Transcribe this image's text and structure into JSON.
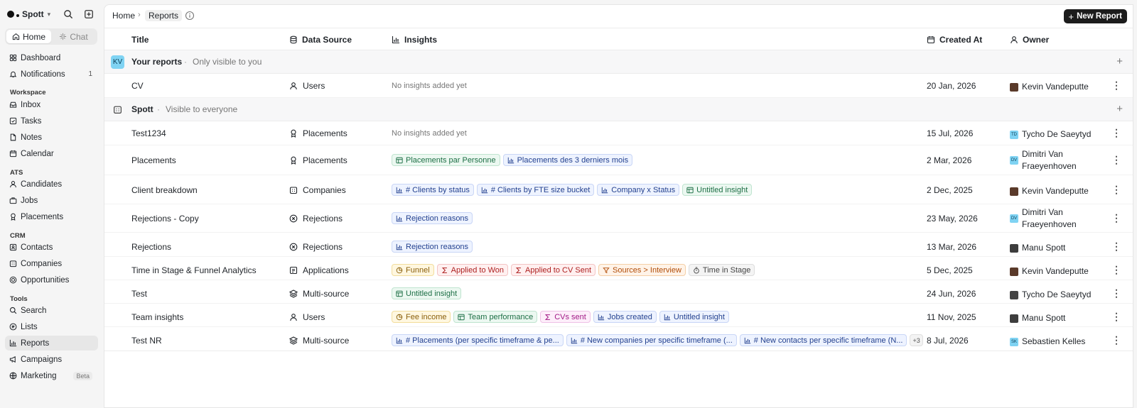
{
  "app": {
    "name": "Spott"
  },
  "sidebar": {
    "tabs": {
      "home": "Home",
      "chat": "Chat"
    },
    "top_items": [
      {
        "label": "Dashboard"
      },
      {
        "label": "Notifications",
        "count": "1"
      }
    ],
    "sections": {
      "workspace": "Workspace",
      "ats": "ATS",
      "crm": "CRM",
      "tools": "Tools"
    },
    "workspace_items": [
      "Inbox",
      "Tasks",
      "Notes",
      "Calendar"
    ],
    "ats_items": [
      "Candidates",
      "Jobs",
      "Placements"
    ],
    "crm_items": [
      "Contacts",
      "Companies",
      "Opportunities"
    ],
    "tools_items": [
      "Search",
      "Lists",
      "Reports",
      "Campaigns",
      "Marketing"
    ],
    "beta_label": "Beta"
  },
  "breadcrumb": {
    "home": "Home",
    "current": "Reports"
  },
  "toolbar": {
    "new_report": "New Report"
  },
  "columns": {
    "title": "Title",
    "data_source": "Data Source",
    "insights": "Insights",
    "created_at": "Created At",
    "owner": "Owner"
  },
  "groups": {
    "yours": {
      "badge": "KV",
      "title": "Your reports",
      "subtitle": "Only visible to you"
    },
    "spott": {
      "title": "Spott",
      "subtitle": "Visible to everyone"
    }
  },
  "empty_insights": "No insights added yet",
  "rows": [
    {
      "title": "CV",
      "source": "Users",
      "date": "20 Jan, 2026",
      "owner": "Kevin Vandeputte"
    },
    {
      "title": "Test1234",
      "source": "Placements",
      "date": "15 Jul, 2026",
      "owner": "Tycho De Saeytyd",
      "owner_initials": "TD"
    },
    {
      "title": "Placements",
      "source": "Placements",
      "date": "2 Mar, 2026",
      "owner_line1": "Dimitri Van",
      "owner_line2": "Fraeyenhoven",
      "owner_initials": "DV",
      "chips": [
        "Placements par Personne",
        "Placements des 3 derniers mois"
      ]
    },
    {
      "title": "Client breakdown",
      "source": "Companies",
      "date": "2 Dec, 2025",
      "owner": "Kevin Vandeputte",
      "chips": [
        "# Clients by status",
        "# Clients by FTE size bucket",
        "Company x Status",
        "Untitled insight"
      ]
    },
    {
      "title": "Rejections - Copy",
      "source": "Rejections",
      "date": "23 May, 2026",
      "owner_line1": "Dimitri Van",
      "owner_line2": "Fraeyenhoven",
      "owner_initials": "DV",
      "chips": [
        "Rejection reasons"
      ]
    },
    {
      "title": "Rejections",
      "source": "Rejections",
      "date": "13 Mar, 2026",
      "owner": "Manu Spott",
      "chips": [
        "Rejection reasons"
      ]
    },
    {
      "title": "Time in Stage & Funnel Analytics",
      "source": "Applications",
      "date": "5 Dec, 2025",
      "owner": "Kevin Vandeputte",
      "chips": [
        "Funnel",
        "Applied to Won",
        "Applied to CV Sent",
        "Sources > Interview",
        "Time in Stage"
      ]
    },
    {
      "title": "Test",
      "source": "Multi-source",
      "date": "24 Jun, 2026",
      "owner": "Tycho De Saeytyd",
      "chips": [
        "Untitled insight"
      ]
    },
    {
      "title": "Team insights",
      "source": "Users",
      "date": "11 Nov, 2025",
      "owner": "Manu Spott",
      "chips": [
        "Fee income",
        "Team performance",
        "CVs sent",
        "Jobs created",
        "Untitled insight"
      ]
    },
    {
      "title": "Test NR",
      "source": "Multi-source",
      "date": "8 Jul, 2026",
      "owner": "Sebastien Kelles",
      "owner_initials": "SK",
      "chips": [
        "# Placements (per specific timeframe & pe...",
        "# New companies per specific timeframe (...",
        "# New contacts per specific timeframe (N..."
      ],
      "more": "+3"
    }
  ]
}
